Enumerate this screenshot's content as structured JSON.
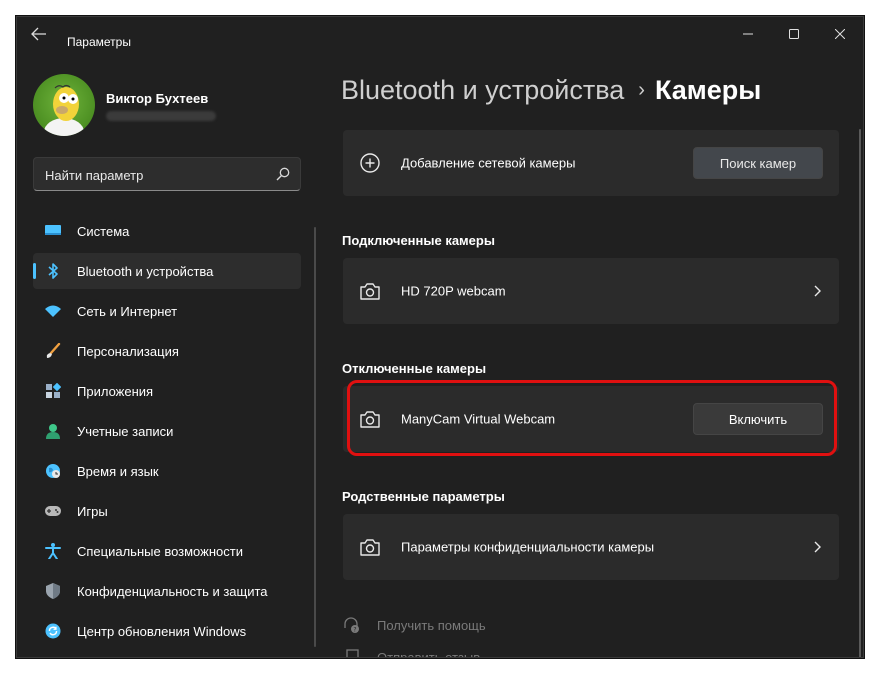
{
  "window": {
    "title": "Параметры"
  },
  "user": {
    "name": "Виктор Бухтеев"
  },
  "search": {
    "placeholder": "Найти параметр"
  },
  "sidebar": {
    "items": [
      {
        "label": "Система",
        "icon": "system-icon",
        "color": "#4cc2ff"
      },
      {
        "label": "Bluetooth и устройства",
        "icon": "bluetooth-icon",
        "color": "#4cc2ff",
        "active": true
      },
      {
        "label": "Сеть и Интернет",
        "icon": "wifi-icon",
        "color": "#4cc2ff"
      },
      {
        "label": "Персонализация",
        "icon": "brush-icon",
        "color": "#f0a040"
      },
      {
        "label": "Приложения",
        "icon": "apps-icon",
        "color": "#9ab0c8"
      },
      {
        "label": "Учетные записи",
        "icon": "account-icon",
        "color": "#3fc88a"
      },
      {
        "label": "Время и язык",
        "icon": "globe-icon",
        "color": "#4cc2ff"
      },
      {
        "label": "Игры",
        "icon": "gamepad-icon",
        "color": "#b8b8b8"
      },
      {
        "label": "Специальные возможности",
        "icon": "accessibility-icon",
        "color": "#4cc2ff"
      },
      {
        "label": "Конфиденциальность и защита",
        "icon": "shield-icon",
        "color": "#9aa4ae"
      },
      {
        "label": "Центр обновления Windows",
        "icon": "update-icon",
        "color": "#4cc2ff"
      }
    ]
  },
  "breadcrumb": {
    "parent": "Bluetooth и устройства",
    "separator": "›",
    "current": "Камеры"
  },
  "main": {
    "add_camera": {
      "label": "Добавление сетевой камеры",
      "button": "Поиск камер"
    },
    "connected": {
      "heading": "Подключенные камеры",
      "items": [
        {
          "label": "HD 720P webcam"
        }
      ]
    },
    "disabled": {
      "heading": "Отключенные камеры",
      "items": [
        {
          "label": "ManyCam Virtual Webcam",
          "button": "Включить"
        }
      ]
    },
    "related": {
      "heading": "Родственные параметры",
      "items": [
        {
          "label": "Параметры конфиденциальности камеры"
        }
      ]
    },
    "links": {
      "help": "Получить помощь",
      "feedback": "Отправить отзыв"
    }
  },
  "colors": {
    "accent": "#4cc2ff",
    "highlight": "#e01010",
    "background": "#202020",
    "card": "#2b2b2b"
  }
}
